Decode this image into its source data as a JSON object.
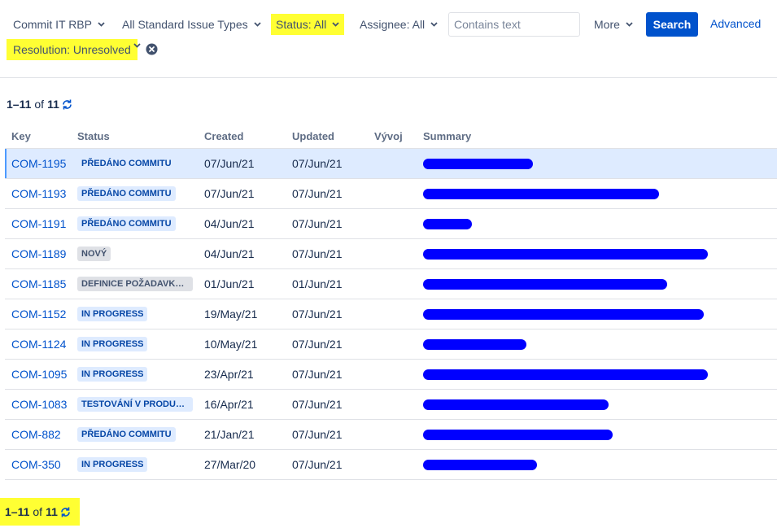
{
  "filters": {
    "project": "Commit IT RBP",
    "issue_types": "All Standard Issue Types",
    "status": "Status: All",
    "assignee": "Assignee: All",
    "search_placeholder": "Contains text",
    "more": "More",
    "search_button": "Search",
    "advanced": "Advanced",
    "resolution": "Resolution: Unresolved"
  },
  "pagination": {
    "range": "1–11",
    "of": "of",
    "total": "11"
  },
  "columns": {
    "key": "Key",
    "status": "Status",
    "created": "Created",
    "updated": "Updated",
    "vyvoj": "Vývoj",
    "summary": "Summary"
  },
  "issues": [
    {
      "key": "COM-1195",
      "status": "PŘEDÁNO COMMITU",
      "status_color": "blue",
      "created": "07/Jun/21",
      "updated": "07/Jun/21",
      "vyvoj": "",
      "summary_redacted": true
    },
    {
      "key": "COM-1193",
      "status": "PŘEDÁNO COMMITU",
      "status_color": "blue",
      "created": "07/Jun/21",
      "updated": "07/Jun/21",
      "vyvoj": "",
      "summary_redacted": true
    },
    {
      "key": "COM-1191",
      "status": "PŘEDÁNO COMMITU",
      "status_color": "blue",
      "created": "04/Jun/21",
      "updated": "07/Jun/21",
      "vyvoj": "",
      "summary_redacted": true
    },
    {
      "key": "COM-1189",
      "status": "NOVÝ",
      "status_color": "gray",
      "created": "04/Jun/21",
      "updated": "07/Jun/21",
      "vyvoj": "",
      "summary_redacted": true
    },
    {
      "key": "COM-1185",
      "status": "DEFINICE POŽADAVKU ...",
      "status_color": "gray",
      "created": "01/Jun/21",
      "updated": "01/Jun/21",
      "vyvoj": "",
      "summary_redacted": true
    },
    {
      "key": "COM-1152",
      "status": "IN PROGRESS",
      "status_color": "blue",
      "created": "19/May/21",
      "updated": "07/Jun/21",
      "vyvoj": "",
      "summary_redacted": true
    },
    {
      "key": "COM-1124",
      "status": "IN PROGRESS",
      "status_color": "blue",
      "created": "10/May/21",
      "updated": "07/Jun/21",
      "vyvoj": "",
      "summary_redacted": true
    },
    {
      "key": "COM-1095",
      "status": "IN PROGRESS",
      "status_color": "blue",
      "created": "23/Apr/21",
      "updated": "07/Jun/21",
      "vyvoj": "",
      "summary_redacted": true
    },
    {
      "key": "COM-1083",
      "status": "TESTOVÁNÍ V PRODUK...",
      "status_color": "blue",
      "created": "16/Apr/21",
      "updated": "07/Jun/21",
      "vyvoj": "",
      "summary_redacted": true
    },
    {
      "key": "COM-882",
      "status": "PŘEDÁNO COMMITU",
      "status_color": "blue",
      "created": "21/Jan/21",
      "updated": "07/Jun/21",
      "vyvoj": "",
      "summary_redacted": true
    },
    {
      "key": "COM-350",
      "status": "IN PROGRESS",
      "status_color": "blue",
      "created": "27/Mar/20",
      "updated": "07/Jun/21",
      "vyvoj": "",
      "summary_redacted": true
    }
  ],
  "colors": {
    "link": "#0052cc",
    "button": "#0052cc",
    "highlight": "#ffff33",
    "redaction": "#0000ff",
    "selected_row": "#deebff"
  },
  "icons": {
    "dropdown": "chevron-down-icon",
    "clear": "clear-icon",
    "refresh": "refresh-icon"
  }
}
